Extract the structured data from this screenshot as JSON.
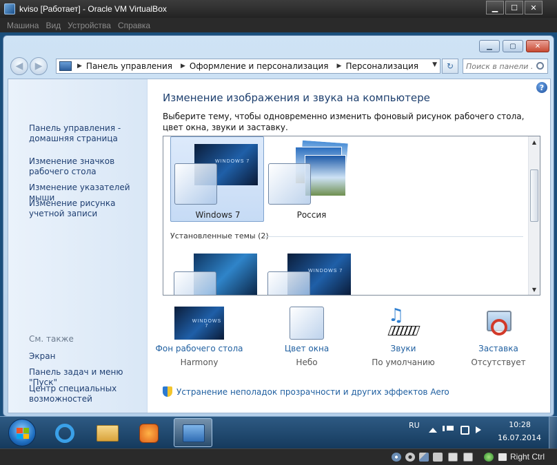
{
  "vbox": {
    "title": "kviso [Работает] - Oracle VM VirtualBox",
    "menu": [
      "Машина",
      "Вид",
      "Устройства",
      "Справка"
    ],
    "controls": {
      "minimize": "▁",
      "maximize": "☐",
      "close": "✕"
    },
    "host_key": "Right Ctrl"
  },
  "explorer": {
    "controls": {
      "minimize": "▁",
      "maximize": "▢",
      "close": "✕"
    },
    "nav": {
      "back": "◀",
      "forward": "▶"
    },
    "breadcrumb": [
      "Панель управления",
      "Оформление и персонализация",
      "Персонализация"
    ],
    "breadcrumb_separator": "▶",
    "address_dropdown": "▼",
    "refresh": "↻",
    "search_placeholder": "Поиск в панели ..."
  },
  "sidebar": {
    "links": [
      "Панель управления - домашняя страница",
      "Изменение значков рабочего стола",
      "Изменение указателей мыши",
      "Изменение рисунка учетной записи"
    ],
    "see_also_title": "См. также",
    "see_also": [
      "Экран",
      "Панель задач и меню \"Пуск\"",
      "Центр специальных возможностей"
    ]
  },
  "main": {
    "help": "?",
    "title": "Изменение изображения и звука на компьютере",
    "description": "Выберите тему, чтобы одновременно изменить фоновый рисунок рабочего стола, цвет окна, звуки и заставку.",
    "themes": [
      {
        "name": "Windows 7",
        "selected": true
      },
      {
        "name": "Россия",
        "selected": false
      }
    ],
    "installed_header": "Установленные темы (2)",
    "scroll": {
      "up": "▲",
      "down": "▼"
    },
    "settings": [
      {
        "label": "Фон рабочего стола",
        "value": "Harmony"
      },
      {
        "label": "Цвет окна",
        "value": "Небо"
      },
      {
        "label": "Звуки",
        "value": "По умолчанию"
      },
      {
        "label": "Заставка",
        "value": "Отсутствует"
      }
    ],
    "aero_link": "Устранение неполадок прозрачности и других эффектов Aero",
    "wallpaper_logo": "WINDOWS 7"
  },
  "taskbar": {
    "language": "RU",
    "time": "10:28",
    "date": "16.07.2014"
  },
  "colors": {
    "link": "#1f5fa0",
    "title": "#1d3f6e",
    "sidebar_link": "#1f3f72",
    "taskbar": "#1f4a71"
  }
}
